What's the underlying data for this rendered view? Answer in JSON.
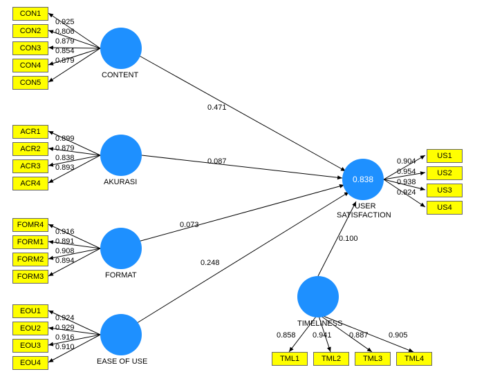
{
  "chart_data": {
    "type": "diagram",
    "title": "",
    "latents": [
      {
        "name": "CONTENT",
        "indicators": [
          {
            "name": "CON1",
            "loading": 0.925
          },
          {
            "name": "CON2",
            "loading": 0.806
          },
          {
            "name": "CON3",
            "loading": 0.879
          },
          {
            "name": "CON4",
            "loading": 0.854
          },
          {
            "name": "CON5",
            "loading": 0.879
          }
        ]
      },
      {
        "name": "AKURASI",
        "indicators": [
          {
            "name": "ACR1",
            "loading": 0.899
          },
          {
            "name": "ACR2",
            "loading": 0.879
          },
          {
            "name": "ACR3",
            "loading": 0.838
          },
          {
            "name": "ACR4",
            "loading": 0.893
          }
        ]
      },
      {
        "name": "FORMAT",
        "indicators": [
          {
            "name": "FOMR4",
            "loading": 0.916
          },
          {
            "name": "FORM1",
            "loading": 0.891
          },
          {
            "name": "FORM2",
            "loading": 0.908
          },
          {
            "name": "FORM3",
            "loading": 0.894
          }
        ]
      },
      {
        "name": "EASE OF USE",
        "indicators": [
          {
            "name": "EOU1",
            "loading": 0.924
          },
          {
            "name": "EOU2",
            "loading": 0.929
          },
          {
            "name": "EOU3",
            "loading": 0.916
          },
          {
            "name": "EOU4",
            "loading": 0.91
          }
        ]
      },
      {
        "name": "TIMELINESS",
        "indicators": [
          {
            "name": "TML1",
            "loading": 0.858
          },
          {
            "name": "TML2",
            "loading": 0.941
          },
          {
            "name": "TML3",
            "loading": 0.887
          },
          {
            "name": "TML4",
            "loading": 0.905
          }
        ]
      },
      {
        "name": "USER SATISFACTION",
        "r2": 0.838,
        "indicators": [
          {
            "name": "US1",
            "loading": 0.904
          },
          {
            "name": "US2",
            "loading": 0.954
          },
          {
            "name": "US3",
            "loading": 0.938
          },
          {
            "name": "US4",
            "loading": 0.924
          }
        ]
      }
    ],
    "paths": [
      {
        "from": "CONTENT",
        "to": "USER SATISFACTION",
        "coef": 0.471
      },
      {
        "from": "AKURASI",
        "to": "USER SATISFACTION",
        "coef": 0.087
      },
      {
        "from": "FORMAT",
        "to": "USER SATISFACTION",
        "coef": 0.073
      },
      {
        "from": "EASE OF USE",
        "to": "USER SATISFACTION",
        "coef": 0.248
      },
      {
        "from": "TIMELINESS",
        "to": "USER SATISFACTION",
        "coef": 0.1
      }
    ]
  },
  "labels": {
    "content": "CONTENT",
    "akurasi": "AKURASI",
    "format": "FORMAT",
    "ease": "EASE OF USE",
    "time": "TIMELINESS",
    "us": "USER",
    "us2": "SATISFACTION",
    "r2": "0.838",
    "con1": "CON1",
    "con2": "CON2",
    "con3": "CON3",
    "con4": "CON4",
    "con5": "CON5",
    "acr1": "ACR1",
    "acr2": "ACR2",
    "acr3": "ACR3",
    "acr4": "ACR4",
    "fomr4": "FOMR4",
    "form1": "FORM1",
    "form2": "FORM2",
    "form3": "FORM3",
    "eou1": "EOU1",
    "eou2": "EOU2",
    "eou3": "EOU3",
    "eou4": "EOU4",
    "tml1": "TML1",
    "tml2": "TML2",
    "tml3": "TML3",
    "tml4": "TML4",
    "usi1": "US1",
    "usi2": "US2",
    "usi3": "US3",
    "usi4": "US4",
    "l_con1": "0.925",
    "l_con2": "0.806",
    "l_con3": "0.879",
    "l_con4": "0.854",
    "l_con5": "0.879",
    "l_acr1": "0.899",
    "l_acr2": "0.879",
    "l_acr3": "0.838",
    "l_acr4": "0.893",
    "l_fomr4": "0.916",
    "l_form1": "0.891",
    "l_form2": "0.908",
    "l_form3": "0.894",
    "l_eou1": "0.924",
    "l_eou2": "0.929",
    "l_eou3": "0.916",
    "l_eou4": "0.910",
    "l_tml1": "0.858",
    "l_tml2": "0.941",
    "l_tml3": "0.887",
    "l_tml4": "0.905",
    "l_us1": "0.904",
    "l_us2": "0.954",
    "l_us3": "0.938",
    "l_us4": "0.924",
    "p_content": "0.471",
    "p_akurasi": "0.087",
    "p_format": "0.073",
    "p_ease": "0.248",
    "p_time": "0.100"
  }
}
